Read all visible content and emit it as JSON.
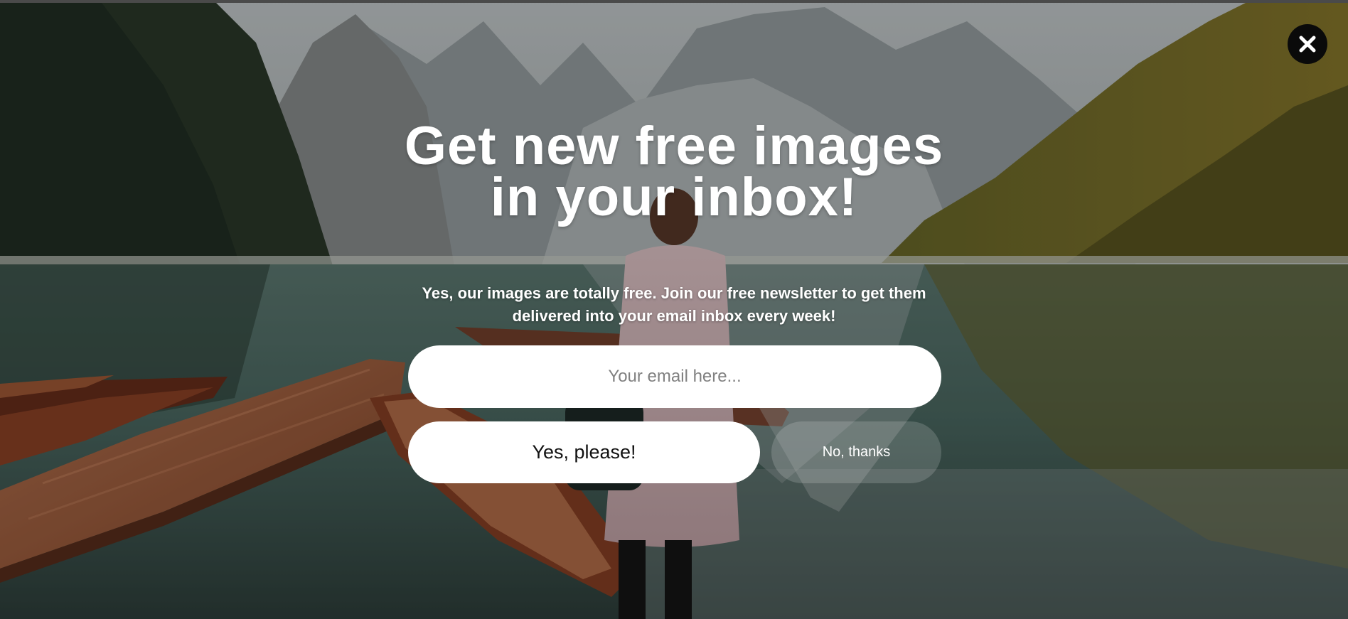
{
  "popup": {
    "headline": "Get new free images in your inbox!",
    "subtext": "Yes, our images are totally free. Join our free newsletter to get them delivered into your email inbox every week!",
    "email_placeholder": "Your email here...",
    "email_value": "",
    "yes_label": "Yes, please!",
    "no_label": "No, thanks"
  },
  "icons": {
    "close": "close-icon"
  },
  "colors": {
    "overlay": "#000000",
    "button_bg": "#ffffff",
    "close_bg": "#0a0a0a"
  }
}
